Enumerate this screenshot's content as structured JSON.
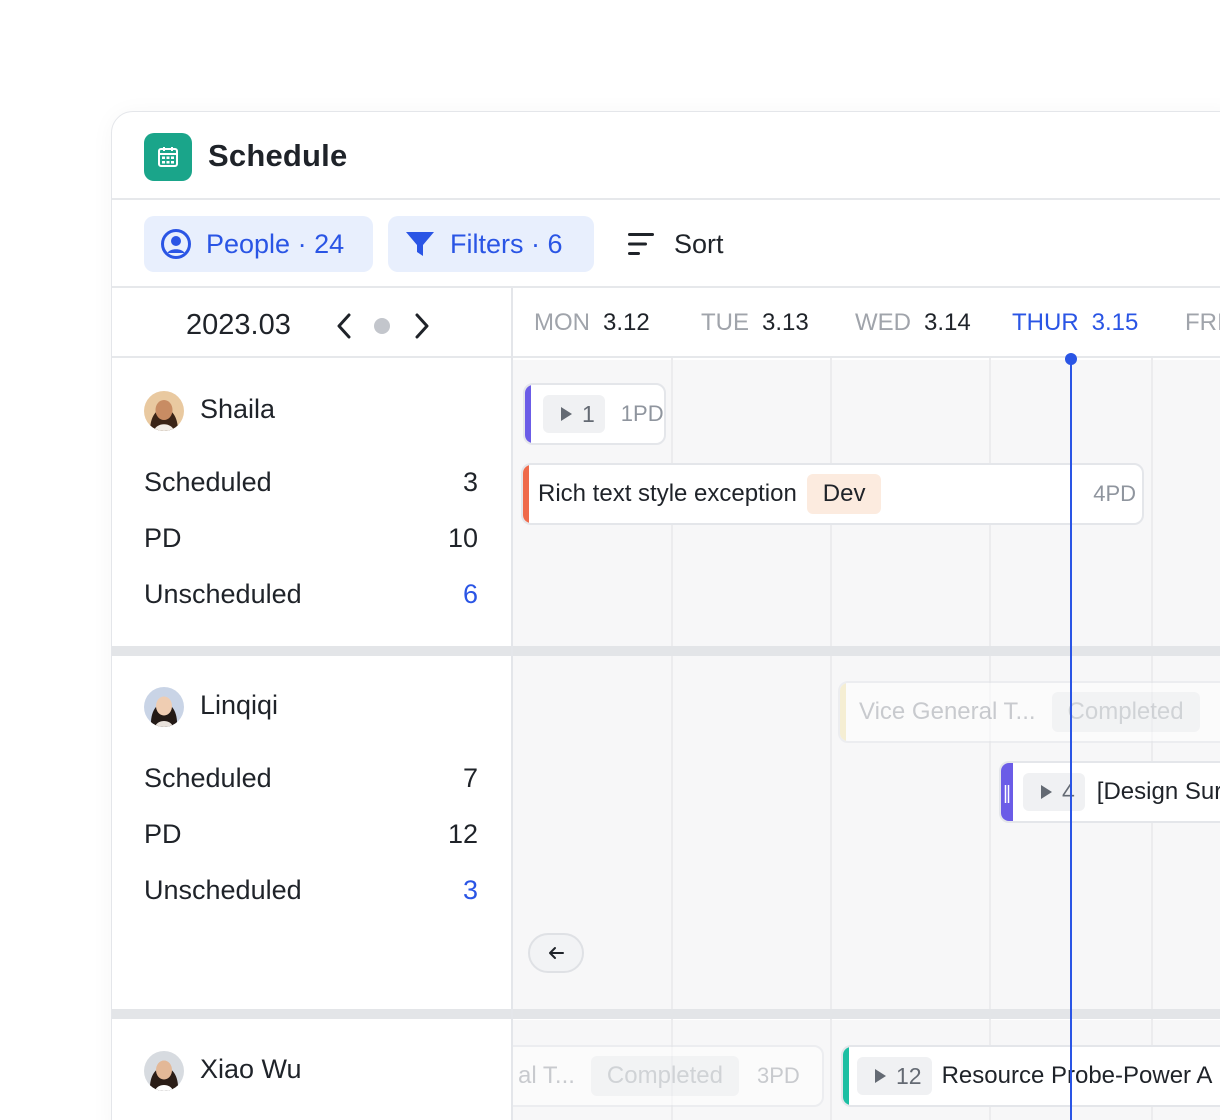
{
  "app": {
    "title": "Schedule",
    "icon": "calendar-icon",
    "accent": "#1aa58a"
  },
  "toolbar": {
    "people_label": "People · 24",
    "filters_label": "Filters · 6",
    "sort_label": "Sort"
  },
  "calendar": {
    "month": "2023.03",
    "days": [
      {
        "name": "MON",
        "date": "3.12",
        "today": false
      },
      {
        "name": "TUE",
        "date": "3.13",
        "today": false
      },
      {
        "name": "WED",
        "date": "3.14",
        "today": false
      },
      {
        "name": "THUR",
        "date": "3.15",
        "today": true
      },
      {
        "name": "FRI",
        "date": "",
        "today": false
      }
    ],
    "today_color": "#2a55e5"
  },
  "people": [
    {
      "name": "Shaila",
      "stats": [
        {
          "label": "Scheduled",
          "value": "3"
        },
        {
          "label": "PD",
          "value": "10"
        },
        {
          "label": "Unscheduled",
          "value": "6"
        }
      ]
    },
    {
      "name": "Linqiqi",
      "stats": [
        {
          "label": "Scheduled",
          "value": "7"
        },
        {
          "label": "PD",
          "value": "12"
        },
        {
          "label": "Unscheduled",
          "value": "3"
        }
      ]
    },
    {
      "name": "Xiao Wu",
      "stats": []
    }
  ],
  "tasks": {
    "shaila_group": {
      "count": "1",
      "pd": "1PD"
    },
    "shaila_task": {
      "title": "Rich text style exception",
      "tag": "Dev",
      "pd": "4PD"
    },
    "linqiqi_completed": {
      "title": "Vice General T...",
      "tag": "Completed"
    },
    "linqiqi_group": {
      "count": "4",
      "title": "[Design Sur"
    },
    "xiaowu_completed": {
      "title": "al T...",
      "tag": "Completed",
      "pd": "3PD"
    },
    "xiaowu_group": {
      "count": "12",
      "title": "Resource Probe-Power A"
    }
  }
}
